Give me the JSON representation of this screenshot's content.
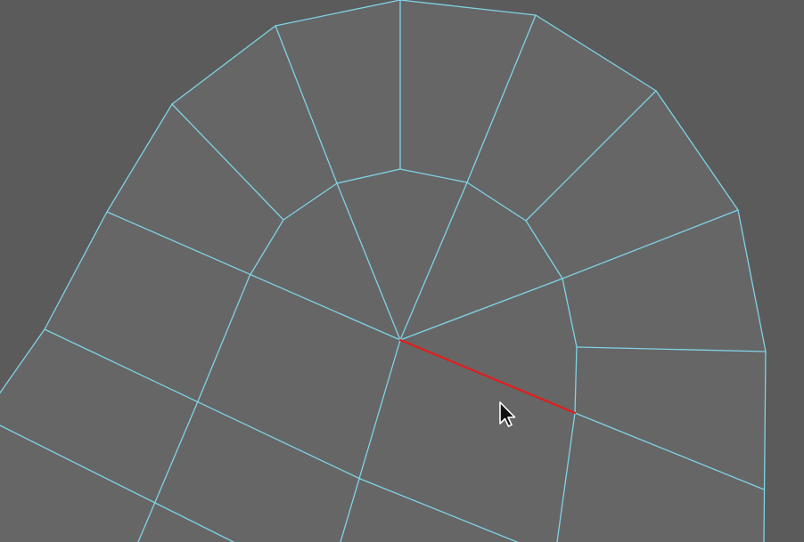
{
  "viewport": {
    "background_color": "#5b5b5b",
    "face_color": "#666666",
    "wire_color": "#7fd3e6",
    "selected_edge_color": "#e51c1c",
    "selection": {
      "element": "edge",
      "count": 1
    },
    "cursor": {
      "icon": "arrow-pointer-icon"
    }
  }
}
